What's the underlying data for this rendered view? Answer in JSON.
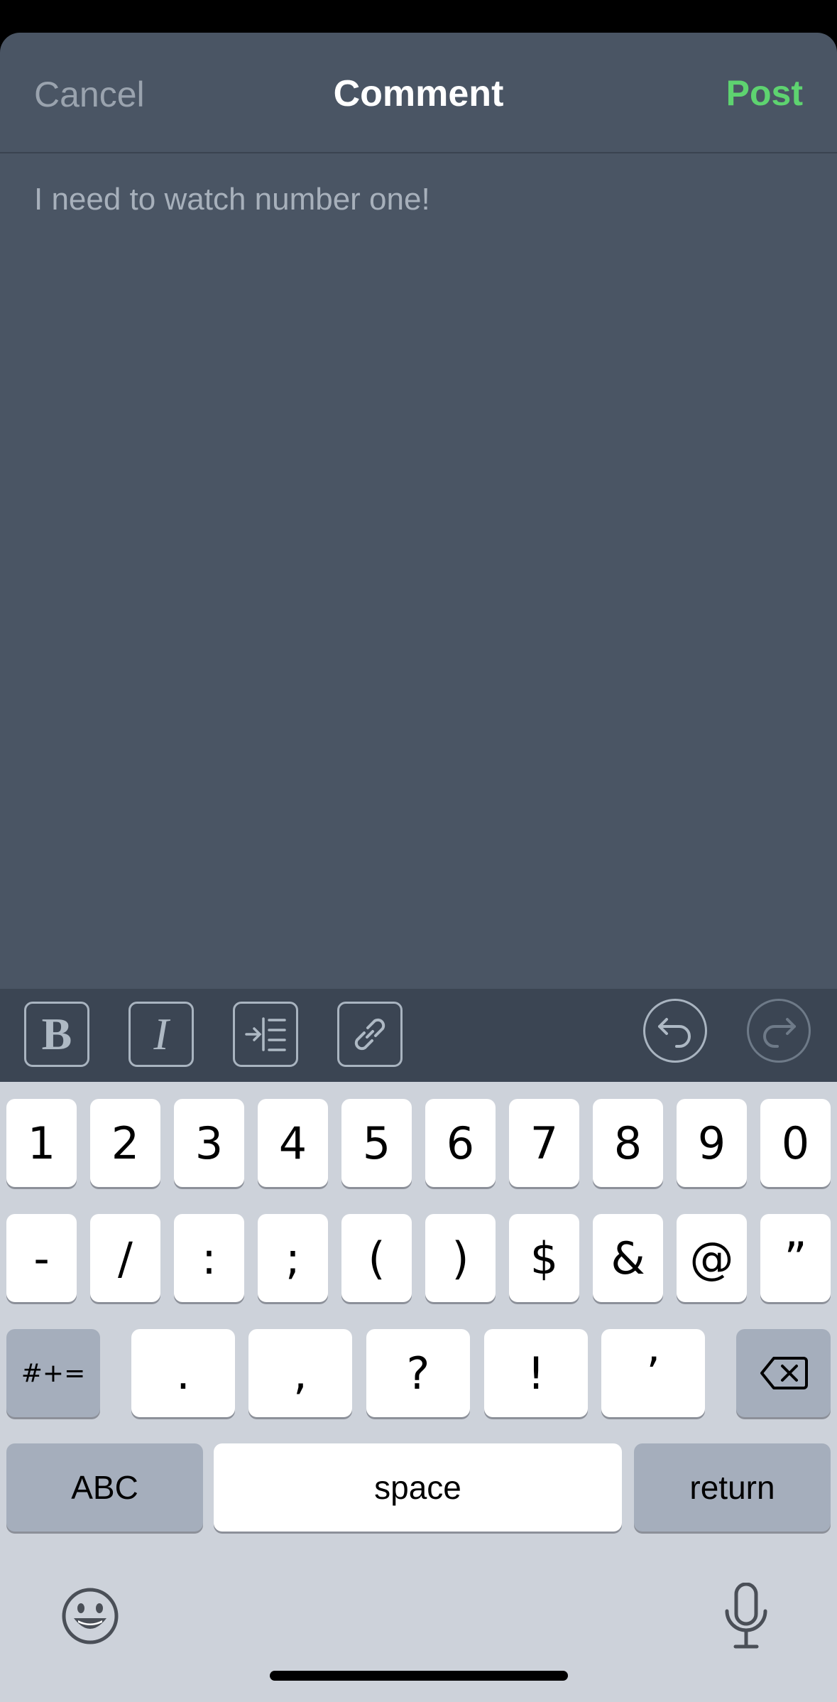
{
  "header": {
    "cancel_label": "Cancel",
    "title": "Comment",
    "post_label": "Post"
  },
  "editor": {
    "value": "I need to watch number one!"
  },
  "toolbar": {
    "bold_label": "B",
    "italic_label": "I",
    "icons": [
      "bold-icon",
      "italic-icon",
      "indent-icon",
      "link-icon",
      "undo-icon",
      "redo-icon"
    ]
  },
  "keyboard": {
    "row1": [
      "1",
      "2",
      "3",
      "4",
      "5",
      "6",
      "7",
      "8",
      "9",
      "0"
    ],
    "row2": [
      "-",
      "/",
      ":",
      ";",
      "(",
      ")",
      "$",
      "&",
      "@",
      "”"
    ],
    "row3": [
      ".",
      ",",
      "?",
      "!",
      "’"
    ],
    "symbols_label": "#+=",
    "abc_label": "ABC",
    "space_label": "space",
    "return_label": "return"
  },
  "colors": {
    "sheet_bg": "#4a5564",
    "toolbar_bg": "#3b4553",
    "accent_post": "#5ed370",
    "keyboard_bg": "#cdd2da"
  }
}
